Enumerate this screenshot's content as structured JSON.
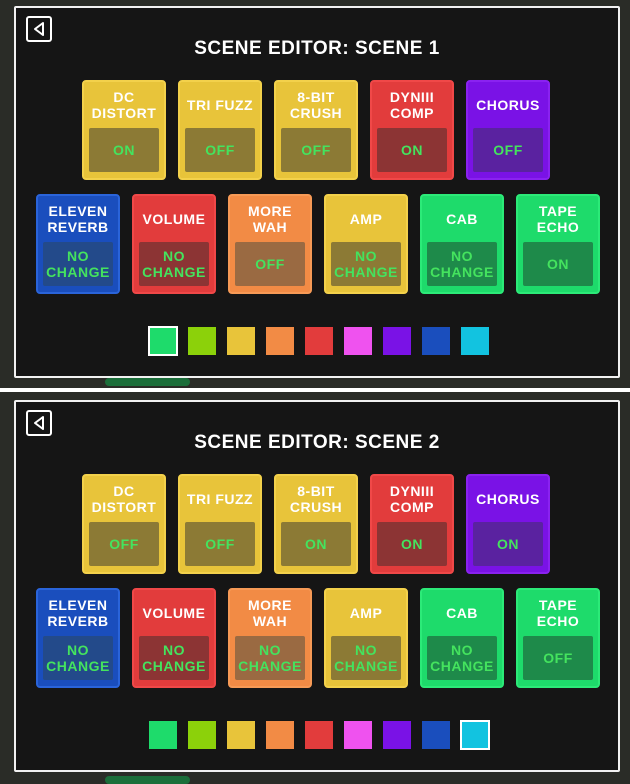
{
  "colors": {
    "accent_on_off": "#44e35e",
    "palette": [
      "#1edb6b",
      "#8cd10a",
      "#e8c43a",
      "#f28b45",
      "#e23c3c",
      "#ef52ef",
      "#7a12e6",
      "#1a4ebd",
      "#12c3e0"
    ]
  },
  "screens": [
    {
      "title": "SCENE EDITOR: SCENE 1",
      "back_icon": "back-arrow-icon",
      "row1": [
        {
          "name": "DC DISTORT",
          "state": "ON",
          "color": "yellow"
        },
        {
          "name": "TRI FUZZ",
          "state": "OFF",
          "color": "yellow"
        },
        {
          "name": "8-BIT CRUSH",
          "state": "OFF",
          "color": "yellow"
        },
        {
          "name": "DYNIII COMP",
          "state": "ON",
          "color": "red"
        },
        {
          "name": "CHORUS",
          "state": "OFF",
          "color": "purple"
        }
      ],
      "row2": [
        {
          "name": "ELEVEN REVERB",
          "state": "NO CHANGE",
          "color": "blue"
        },
        {
          "name": "VOLUME",
          "state": "NO CHANGE",
          "color": "red"
        },
        {
          "name": "MORE WAH",
          "state": "OFF",
          "color": "orange"
        },
        {
          "name": "AMP",
          "state": "NO CHANGE",
          "color": "yellow"
        },
        {
          "name": "CAB",
          "state": "NO CHANGE",
          "color": "green"
        },
        {
          "name": "TAPE ECHO",
          "state": "ON",
          "color": "green"
        }
      ],
      "selected_swatch": 0
    },
    {
      "title": "SCENE EDITOR: SCENE 2",
      "back_icon": "back-arrow-icon",
      "row1": [
        {
          "name": "DC DISTORT",
          "state": "OFF",
          "color": "yellow"
        },
        {
          "name": "TRI FUZZ",
          "state": "OFF",
          "color": "yellow"
        },
        {
          "name": "8-BIT CRUSH",
          "state": "ON",
          "color": "yellow"
        },
        {
          "name": "DYNIII COMP",
          "state": "ON",
          "color": "red"
        },
        {
          "name": "CHORUS",
          "state": "ON",
          "color": "purple"
        }
      ],
      "row2": [
        {
          "name": "ELEVEN REVERB",
          "state": "NO CHANGE",
          "color": "blue"
        },
        {
          "name": "VOLUME",
          "state": "NO CHANGE",
          "color": "red"
        },
        {
          "name": "MORE WAH",
          "state": "NO CHANGE",
          "color": "orange"
        },
        {
          "name": "AMP",
          "state": "NO CHANGE",
          "color": "yellow"
        },
        {
          "name": "CAB",
          "state": "NO CHANGE",
          "color": "green"
        },
        {
          "name": "TAPE ECHO",
          "state": "OFF",
          "color": "green"
        }
      ],
      "selected_swatch": 8
    }
  ]
}
